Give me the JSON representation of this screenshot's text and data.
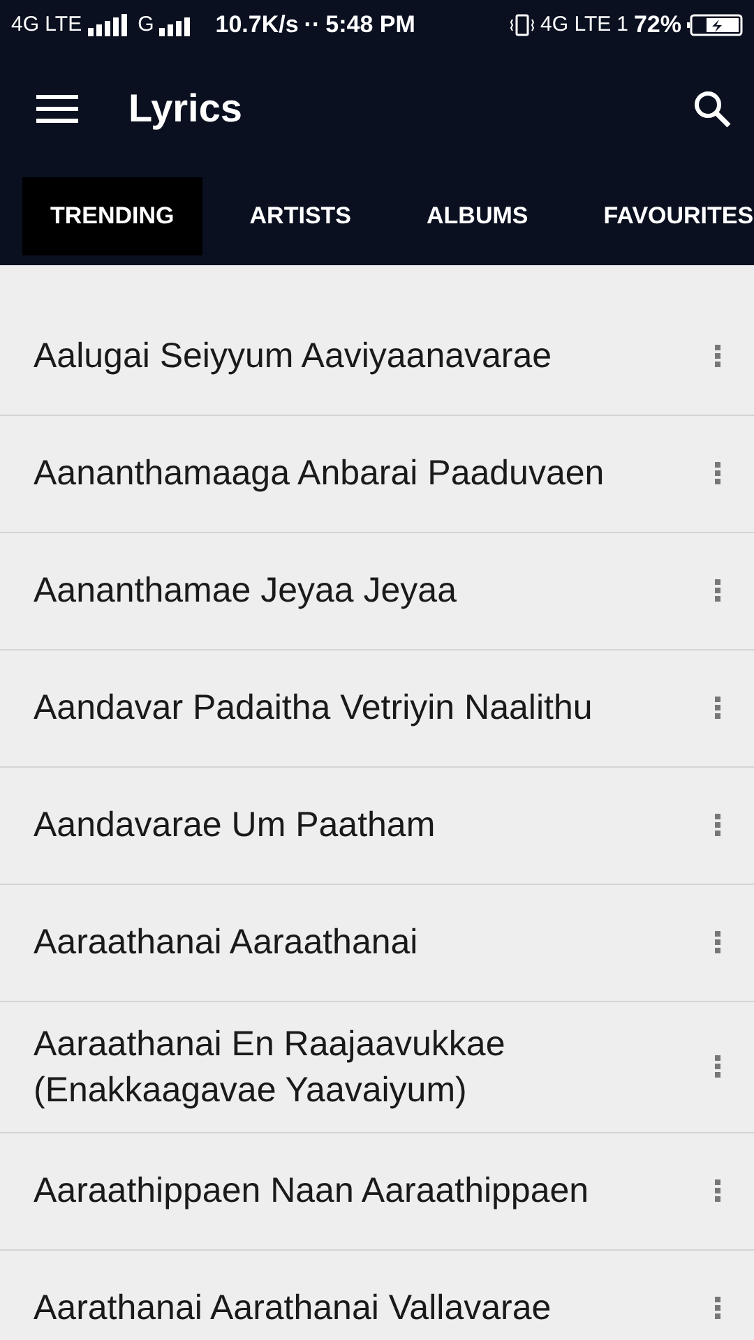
{
  "status_bar": {
    "network_1": "4G LTE",
    "network_2": "G",
    "speed": "10.7K/s",
    "dots": "··",
    "time": "5:48 PM",
    "network_3": "4G LTE",
    "sim": "1",
    "battery": "72%"
  },
  "app_bar": {
    "title": "Lyrics"
  },
  "tabs": [
    {
      "label": "TRENDING",
      "selected": true
    },
    {
      "label": "ARTISTS",
      "selected": false
    },
    {
      "label": "ALBUMS",
      "selected": false
    },
    {
      "label": "FAVOURITES",
      "selected": false
    }
  ],
  "songs": [
    {
      "title": "Aalugai Seiyyum Aaviyaanavarae"
    },
    {
      "title": "Aananthamaaga Anbarai Paaduvaen"
    },
    {
      "title": "Aananthamae Jeyaa Jeyaa"
    },
    {
      "title": "Aandavar Padaitha Vetriyin Naalithu"
    },
    {
      "title": "Aandavarae Um Paatham"
    },
    {
      "title": "Aaraathanai Aaraathanai"
    },
    {
      "title": "Aaraathanai En Raajaavukkae (Enakkaagavae Yaavaiyum)"
    },
    {
      "title": "Aaraathippaen Naan Aaraathippaen"
    },
    {
      "title": "Aarathanai Aarathanai Vallavarae"
    }
  ]
}
